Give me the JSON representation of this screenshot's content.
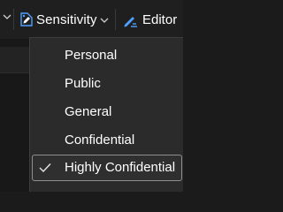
{
  "toolbar": {
    "sensitivity_label": "Sensitivity",
    "editor_label": "Editor"
  },
  "sensitivity_menu": {
    "items": [
      {
        "label": "Personal",
        "checked": false
      },
      {
        "label": "Public",
        "checked": false
      },
      {
        "label": "General",
        "checked": false
      },
      {
        "label": "Confidential",
        "checked": false
      },
      {
        "label": "Highly Confidential",
        "checked": true
      }
    ]
  },
  "colors": {
    "background": "#1b1b1b",
    "menu_background": "#2b2b2b",
    "accent_blue": "#4ea1ff",
    "text": "#ffffff"
  }
}
